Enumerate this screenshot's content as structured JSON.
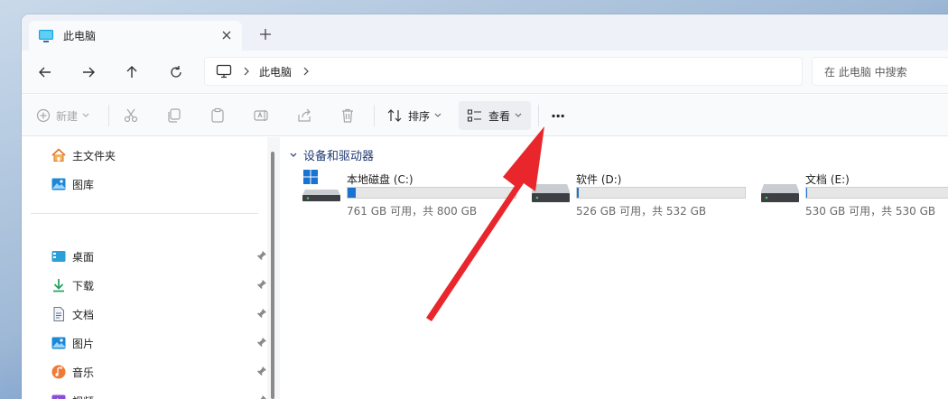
{
  "window": {
    "tab_title": "此电脑",
    "new_tab": "+"
  },
  "navigation": {
    "address_root": "此电脑",
    "search_placeholder": "在 此电脑 中搜索"
  },
  "toolbar": {
    "new_label": "新建",
    "sort_label": "排序",
    "view_label": "查看",
    "more_label": "···"
  },
  "sidebar": {
    "top_items": [
      {
        "label": "主文件夹",
        "icon": "home-icon"
      },
      {
        "label": "图库",
        "icon": "gallery-icon"
      }
    ],
    "pinned_items": [
      {
        "label": "桌面",
        "icon": "desktop-icon"
      },
      {
        "label": "下载",
        "icon": "download-icon"
      },
      {
        "label": "文档",
        "icon": "document-icon"
      },
      {
        "label": "图片",
        "icon": "pictures-icon"
      },
      {
        "label": "音乐",
        "icon": "music-icon"
      },
      {
        "label": "视频",
        "icon": "video-icon"
      }
    ]
  },
  "content": {
    "group_title": "设备和驱动器",
    "drives": [
      {
        "name": "本地磁盘 (C:)",
        "info": "761 GB 可用，共 800 GB",
        "used_fraction": 0.05,
        "system": true
      },
      {
        "name": "软件 (D:)",
        "info": "526 GB 可用，共 532 GB",
        "used_fraction": 0.01,
        "system": false
      },
      {
        "name": "文档 (E:)",
        "info": "530 GB 可用，共 530 GB",
        "used_fraction": 0.003,
        "system": false
      }
    ]
  },
  "colors": {
    "accent": "#1a73d0",
    "annotation_arrow": "#e8262c"
  }
}
